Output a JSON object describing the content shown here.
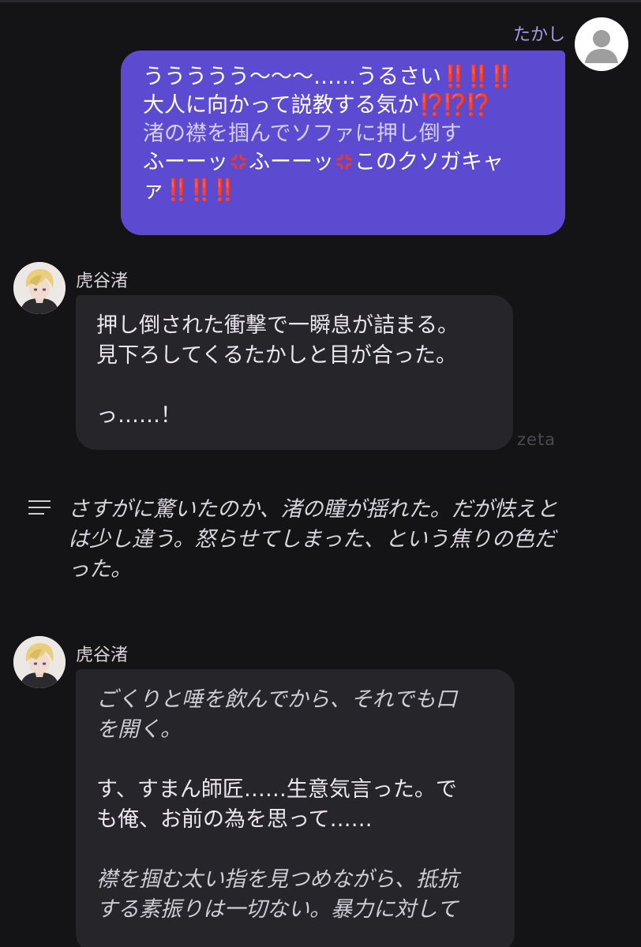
{
  "user_message": {
    "name": "たかし",
    "line1": "ううううう〜〜〜……うるさい",
    "line1_marks": "‼️‼️‼️",
    "line2": "大人に向かって説教する気か",
    "line2_marks": "⁉️⁉️⁉️",
    "action": "渚の襟を掴んでソファに押し倒す",
    "line4a": "ふーーッ",
    "line4b": "ふーーッ",
    "line4c": "このクソガキャ",
    "line5": "ァ",
    "line5_marks": "‼️‼️‼️"
  },
  "bot_messages": [
    {
      "name": "虎谷渚",
      "lines": [
        "押し倒された衝撃で一瞬息が詰まる。",
        "見下ろしてくるたかしと目が合った。",
        "っ……！"
      ]
    },
    {
      "name": "虎谷渚",
      "italic_lines": [
        "ごくりと唾を飲んでから、それでも口",
        "を開く。"
      ],
      "speech_lines": [
        "す、すまん師匠……生意気言った。で",
        "も俺、お前の為を思って……"
      ],
      "italic_lines2": [
        "襟を掴む太い指を見つめながら、抵抗",
        "する素振りは一切ない。暴力に対して"
      ]
    }
  ],
  "watermark": "zeta",
  "narration": {
    "lines": [
      "さすがに驚いたのか、渚の瞳が揺れた。だが怯えと",
      "は少し違う。怒らせてしまった、という焦りの色だ",
      "った。"
    ]
  }
}
